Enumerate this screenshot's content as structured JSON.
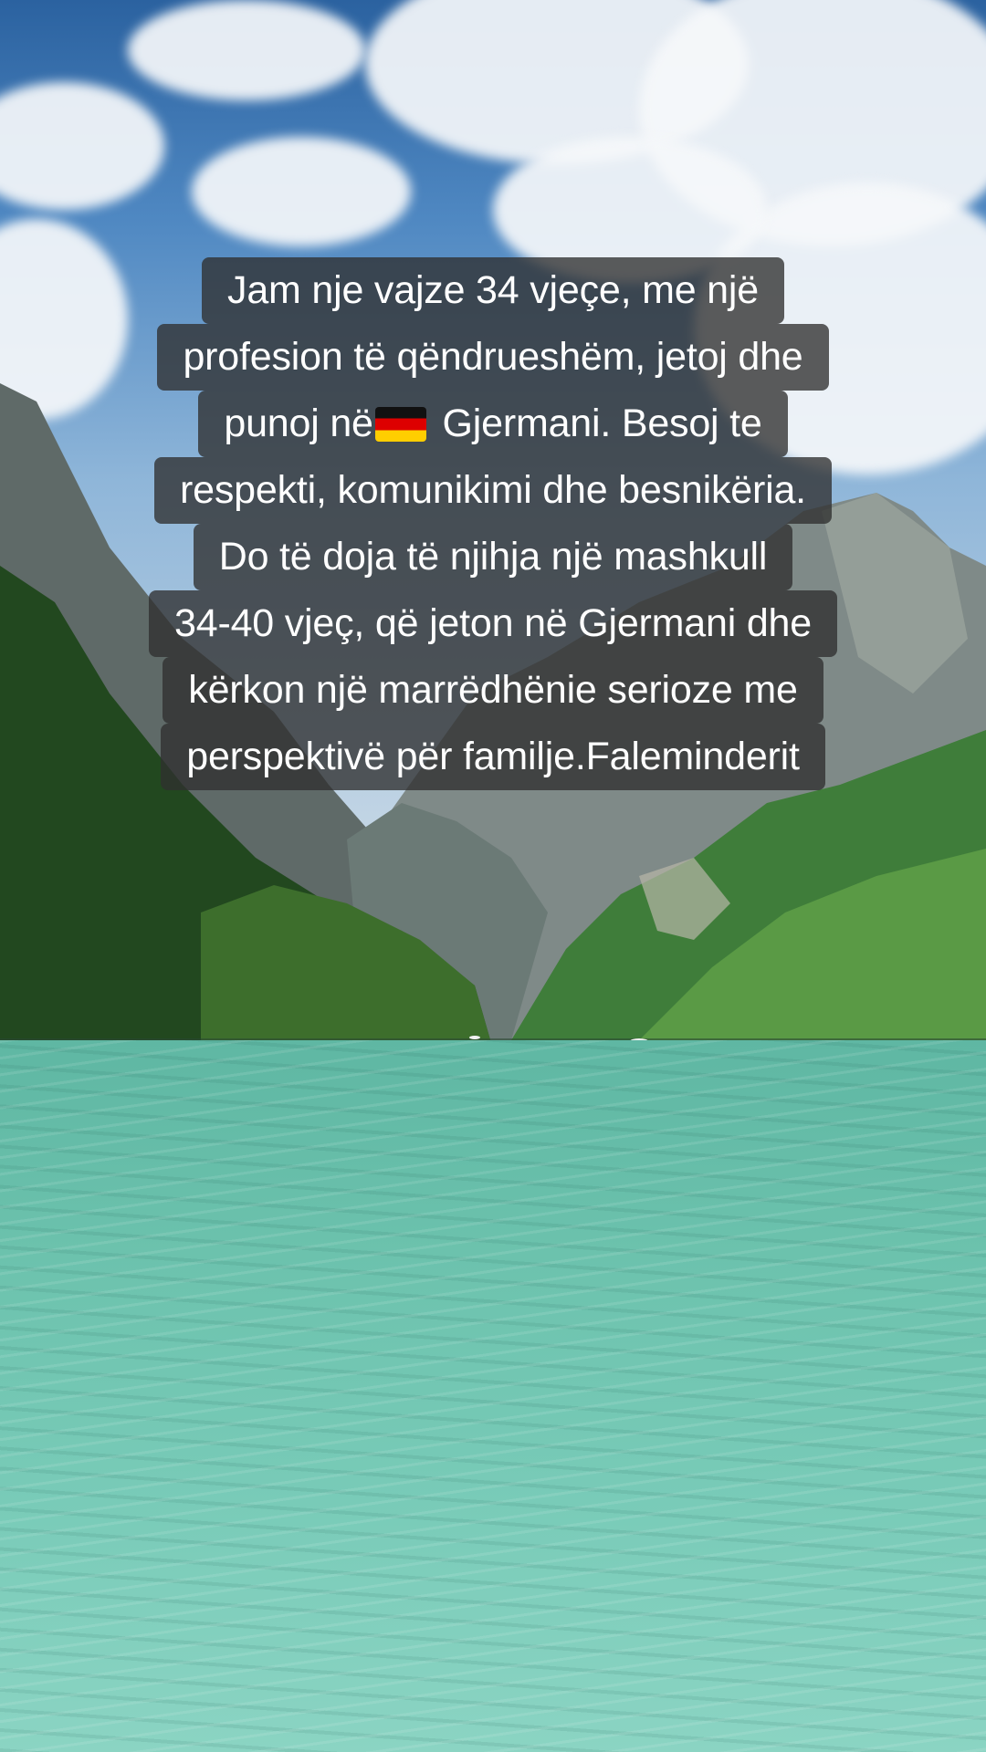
{
  "caption": {
    "lines": [
      "Jam nje vajze 34 vjeçe, me një",
      "profesion të qëndrueshëm, jetoj dhe",
      "punoj në",
      "Gjermani. Besoj te",
      "respekti, komunikimi dhe besnikëria.",
      "Do të doja të njihja një mashkull",
      "34-40 vjeç, që jeton në Gjermani dhe",
      "kërkon një marrëdhënie serioze me",
      "perspektivë për familje.Faleminderit"
    ],
    "flag_icon": "germany-flag-emoji"
  },
  "colors": {
    "caption_background": "#303030",
    "caption_text": "#ffffff",
    "water": "#6cc2ad",
    "sky": "#4f88c2"
  }
}
